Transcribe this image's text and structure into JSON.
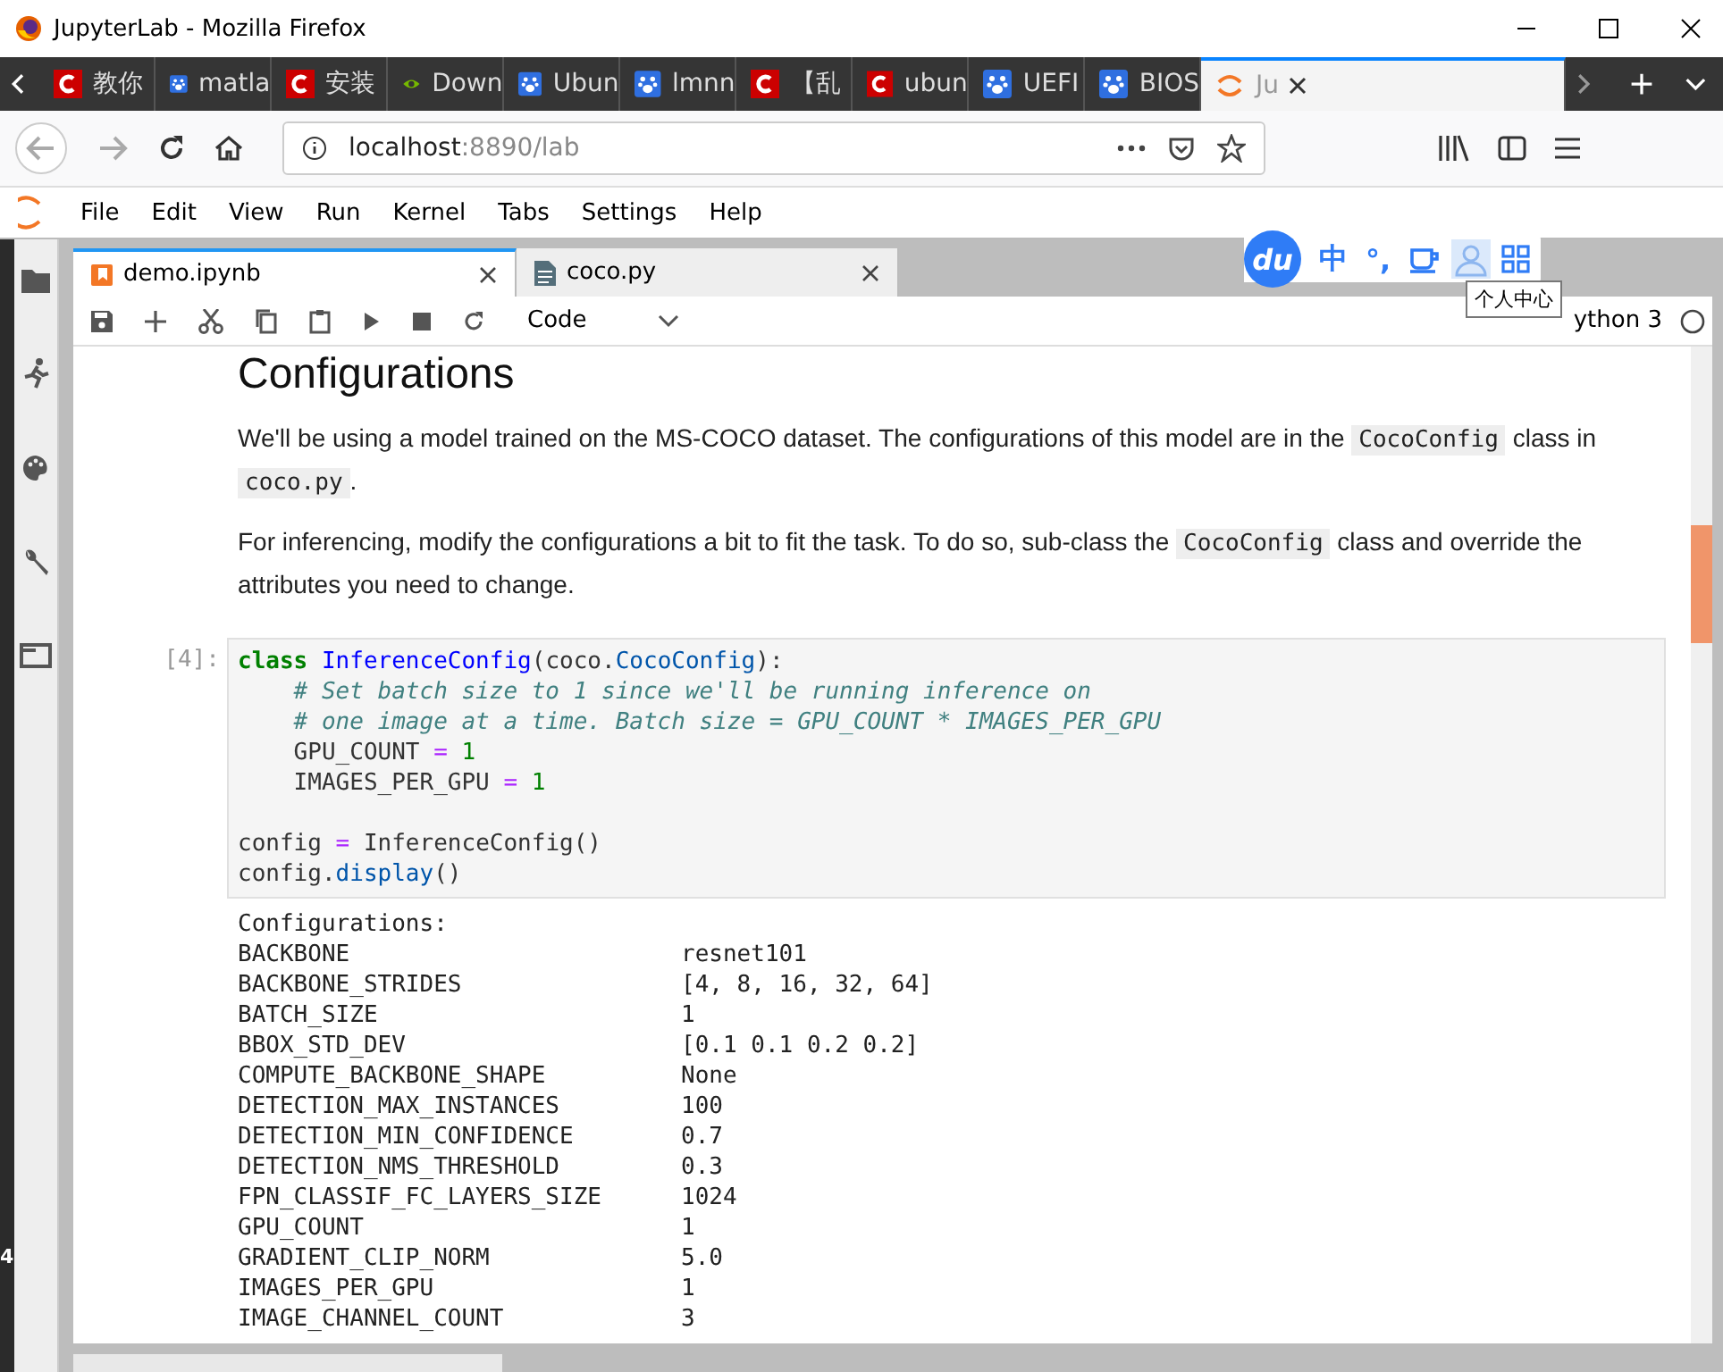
{
  "window": {
    "title": "JupyterLab - Mozilla Firefox"
  },
  "browser_tabs": [
    {
      "label": "教你",
      "selected": false
    },
    {
      "label": "matla",
      "selected": false
    },
    {
      "label": "安装",
      "selected": false
    },
    {
      "label": "Down",
      "selected": false
    },
    {
      "label": "Ubun",
      "selected": false
    },
    {
      "label": "lmnn",
      "selected": false
    },
    {
      "label": "【乱",
      "selected": false
    },
    {
      "label": "ubun",
      "selected": false
    },
    {
      "label": "UEFI",
      "selected": false
    },
    {
      "label": "BIOS",
      "selected": false
    },
    {
      "label": "Ju",
      "selected": true
    }
  ],
  "address_bar": {
    "host": "localhost",
    "path": ":8890/lab"
  },
  "menu": [
    "File",
    "Edit",
    "View",
    "Run",
    "Kernel",
    "Tabs",
    "Settings",
    "Help"
  ],
  "doc_tabs": [
    {
      "label": "demo.ipynb",
      "kind": "notebook",
      "selected": true
    },
    {
      "label": "coco.py",
      "kind": "file",
      "selected": false
    }
  ],
  "toolbar": {
    "cell_type": "Code",
    "kernel": "ython 3"
  },
  "ime_bar": {
    "logo": "du",
    "items": [
      "中",
      "°,"
    ],
    "tooltip": "个人中心"
  },
  "side_number": "4",
  "notebook": {
    "heading": "Configurations",
    "paragraphs": [
      [
        {
          "kind": "text",
          "text": "We'll be using a model trained on the MS-COCO dataset. The configurations of this model are in the "
        },
        {
          "kind": "code",
          "text": "CocoConfig"
        },
        {
          "kind": "text",
          "text": " class in "
        },
        {
          "kind": "code",
          "text": "coco.py"
        },
        {
          "kind": "text",
          "text": "."
        }
      ],
      [
        {
          "kind": "text",
          "text": "For inferencing, modify the configurations a bit to fit the task. To do so, sub-class the "
        },
        {
          "kind": "code",
          "text": "CocoConfig"
        },
        {
          "kind": "text",
          "text": " class and override the attributes you need to change."
        }
      ]
    ],
    "cell": {
      "prompt": "[4]:",
      "blocks": [
        [
          [
            {
              "kind": "kw",
              "text": "class"
            },
            {
              "kind": "cls",
              "text": " InferenceConfig"
            },
            {
              "kind": "plain",
              "text": "(coco."
            },
            {
              "kind": "attr",
              "text": "CocoConfig"
            },
            {
              "kind": "plain",
              "text": "):"
            }
          ],
          [
            {
              "kind": "comment",
              "text": "    # Set batch size to 1 since we'll be running inference on"
            }
          ],
          [
            {
              "kind": "comment",
              "text": "    # one image at a time. Batch size = GPU_COUNT * IMAGES_PER_GPU"
            }
          ],
          [
            {
              "kind": "plain",
              "text": "    GPU_COUNT "
            },
            {
              "kind": "op",
              "text": "="
            },
            {
              "kind": "num",
              "text": " 1"
            }
          ],
          [
            {
              "kind": "plain",
              "text": "    IMAGES_PER_GPU "
            },
            {
              "kind": "op",
              "text": "="
            },
            {
              "kind": "num",
              "text": " 1"
            }
          ]
        ],
        [
          [
            {
              "kind": "plain",
              "text": "config "
            },
            {
              "kind": "op",
              "text": "="
            },
            {
              "kind": "plain",
              "text": " InferenceConfig()"
            }
          ],
          [
            {
              "kind": "plain",
              "text": "config."
            },
            {
              "kind": "attr",
              "text": "display"
            },
            {
              "kind": "plain",
              "text": "()"
            }
          ]
        ]
      ]
    },
    "output": {
      "title": "Configurations:",
      "rows": [
        {
          "name": "BACKBONE",
          "value": "resnet101"
        },
        {
          "name": "BACKBONE_STRIDES",
          "value": "[4, 8, 16, 32, 64]"
        },
        {
          "name": "BATCH_SIZE",
          "value": "1"
        },
        {
          "name": "BBOX_STD_DEV",
          "value": "[0.1 0.1 0.2 0.2]"
        },
        {
          "name": "COMPUTE_BACKBONE_SHAPE",
          "value": "None"
        },
        {
          "name": "DETECTION_MAX_INSTANCES",
          "value": "100"
        },
        {
          "name": "DETECTION_MIN_CONFIDENCE",
          "value": "0.7"
        },
        {
          "name": "DETECTION_NMS_THRESHOLD",
          "value": "0.3"
        },
        {
          "name": "FPN_CLASSIF_FC_LAYERS_SIZE",
          "value": "1024"
        },
        {
          "name": "GPU_COUNT",
          "value": "1"
        },
        {
          "name": "GRADIENT_CLIP_NORM",
          "value": "5.0"
        },
        {
          "name": "IMAGES_PER_GPU",
          "value": "1"
        },
        {
          "name": "IMAGE_CHANNEL_COUNT",
          "value": "3"
        }
      ]
    }
  }
}
